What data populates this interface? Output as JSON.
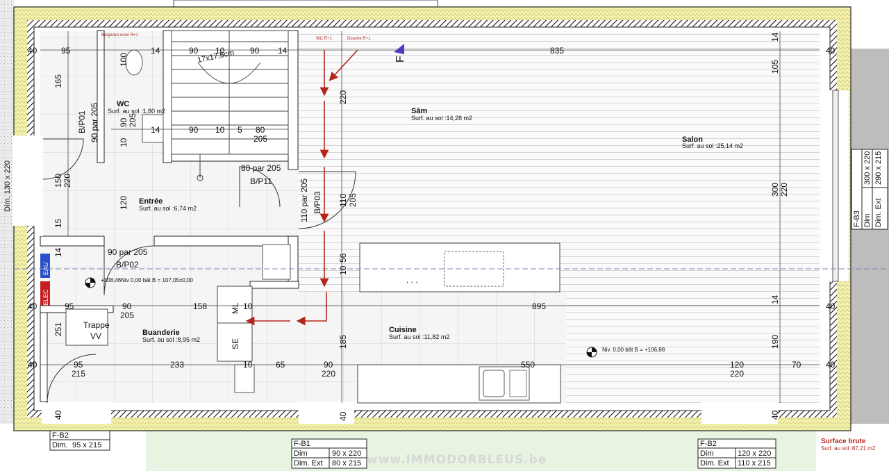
{
  "rooms": {
    "wc": {
      "name": "WC",
      "surface": "Surf. au sol :1,80 m2"
    },
    "entree": {
      "name": "Entrée",
      "surface": "Surf. au sol :6,74 m2"
    },
    "sam": {
      "name": "Sâm",
      "surface": "Surf. au sol :14,28 m2"
    },
    "salon": {
      "name": "Salon",
      "surface": "Surf. au sol :25,14 m2"
    },
    "buanderie": {
      "name": "Buanderie",
      "surface": "Surf. au sol :8,95 m2"
    },
    "cuisine": {
      "name": "Cuisine",
      "surface": "Surf. au sol :11,82 m2"
    }
  },
  "doors": {
    "bp01": {
      "size": "90 par 205",
      "id": "B/P01"
    },
    "bp11": {
      "size": "80 par 205",
      "id": "B/P11"
    },
    "bp03": {
      "size": "110 par 205",
      "id": "B/P03"
    },
    "bp02": {
      "size": "90 par 205",
      "id": "B/P02"
    }
  },
  "stairs": {
    "label": "17x17,5cm"
  },
  "labels": {
    "trappe": "Trappe",
    "trappe_code": "VV",
    "eau": "EAU",
    "elec": "ELEC",
    "ml": "ML",
    "se": "SE",
    "f_marker": "F",
    "wc_r1": "WC R+1",
    "douche_r1": "Douche R+1",
    "baignoire": "Baignoire évier R+1"
  },
  "levels": {
    "buanderie": "+108,46Niv 0,00 bât B = 107,05±0,00",
    "salon": "Niv. 0,00 bât B = +106,88"
  },
  "frames": {
    "fb1": {
      "title": "F-B1",
      "dim_label": "Dim",
      "dim": "90 x 220",
      "ext_label": "Dim. Ext",
      "ext": "80 x 215"
    },
    "fb2": {
      "title": "F-B2",
      "dim_label": "Dim",
      "dim": "120 x 220",
      "ext_label": "Dim. Ext",
      "ext": "110 x 215"
    },
    "fb2_left": {
      "title": "F-B2",
      "ext_label": "Dim.",
      "ext": "95 x 215"
    },
    "fb3": {
      "title": "F-B3",
      "dim_label": "Dim",
      "dim": "300 x 220",
      "ext_label": "Dim. Ext",
      "ext": "290 x 215"
    },
    "left_dim": "Dim. 130 x 220"
  },
  "surface_brute": {
    "title": "Surface brute",
    "value": "Surf. au sol :87,21 m2"
  },
  "watermark": "www.IMMODORBLEUS.be",
  "dimensions": {
    "top_40": "40",
    "top_95": "95",
    "top_14a": "14",
    "top_90a": "90",
    "top_10a": "10",
    "top_90b": "90",
    "top_14b": "14",
    "top_835": "835",
    "stair_90": "90",
    "stair_10": "10",
    "stair_5": "5",
    "stair_80": "80",
    "stair_205": "205",
    "stair_14": "14",
    "wc_165": "165",
    "wc_100": "100",
    "wc_90": "90",
    "wc_205": "205",
    "wc_10": "10",
    "entry_150": "150",
    "entry_220": "220",
    "entry_120": "120",
    "entry_15": "15",
    "sam_220": "220",
    "sam_110": "110",
    "sam_205": "205",
    "sam_10": "10",
    "sam_56": "56",
    "sam_185": "185",
    "r_105": "105",
    "r_300": "300",
    "r_220": "220",
    "r_190": "190",
    "r_14a": "14",
    "r_14b": "14",
    "r_40a": "40",
    "r_40b": "40",
    "r_40c": "40",
    "bot_40l": "40",
    "bot_95": "95",
    "bot_90": "90",
    "bot_205": "205",
    "bot_158": "158",
    "bot_10": "10",
    "bot_895": "895",
    "bot_251": "251",
    "bot_15": "15",
    "bot_95b": "95",
    "bot_215": "215",
    "bot_233": "233",
    "bot_10b": "10",
    "bot_65": "65",
    "bot_90b": "90",
    "bot_220": "220",
    "bot_550": "550",
    "bot_120": "120",
    "bot_220b": "220",
    "bot_70": "70",
    "bot_40a": "40",
    "bot_40b": "40",
    "bot_40c": "40",
    "left_14": "14",
    "left_40a": "40",
    "left_40b": "40"
  }
}
